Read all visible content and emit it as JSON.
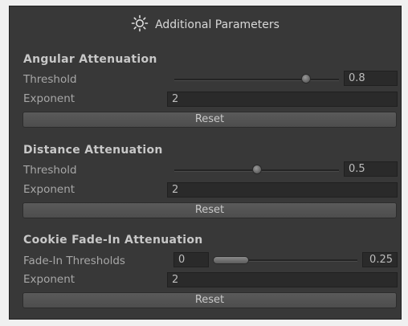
{
  "header": {
    "title": "Additional Parameters",
    "icon": "sun-icon"
  },
  "angular": {
    "title": "Angular Attenuation",
    "threshold_label": "Threshold",
    "threshold_value": "0.8",
    "threshold_level": 0.8,
    "exponent_label": "Exponent",
    "exponent_value": "2",
    "reset_label": "Reset"
  },
  "distance": {
    "title": "Distance Attenuation",
    "threshold_label": "Threshold",
    "threshold_value": "0.5",
    "threshold_level": 0.5,
    "exponent_label": "Exponent",
    "exponent_value": "2",
    "reset_label": "Reset"
  },
  "cookie": {
    "title": "Cookie Fade-In Attenuation",
    "thresholds_label": "Fade-In Thresholds",
    "min_value": "0",
    "max_value": "0.25",
    "range_min": 0,
    "range_max": 0.25,
    "exponent_label": "Exponent",
    "exponent_value": "2",
    "reset_label": "Reset"
  },
  "colors": {
    "panel_bg": "#383838",
    "field_bg": "#2a2a2a",
    "text": "#a7a7a7"
  }
}
